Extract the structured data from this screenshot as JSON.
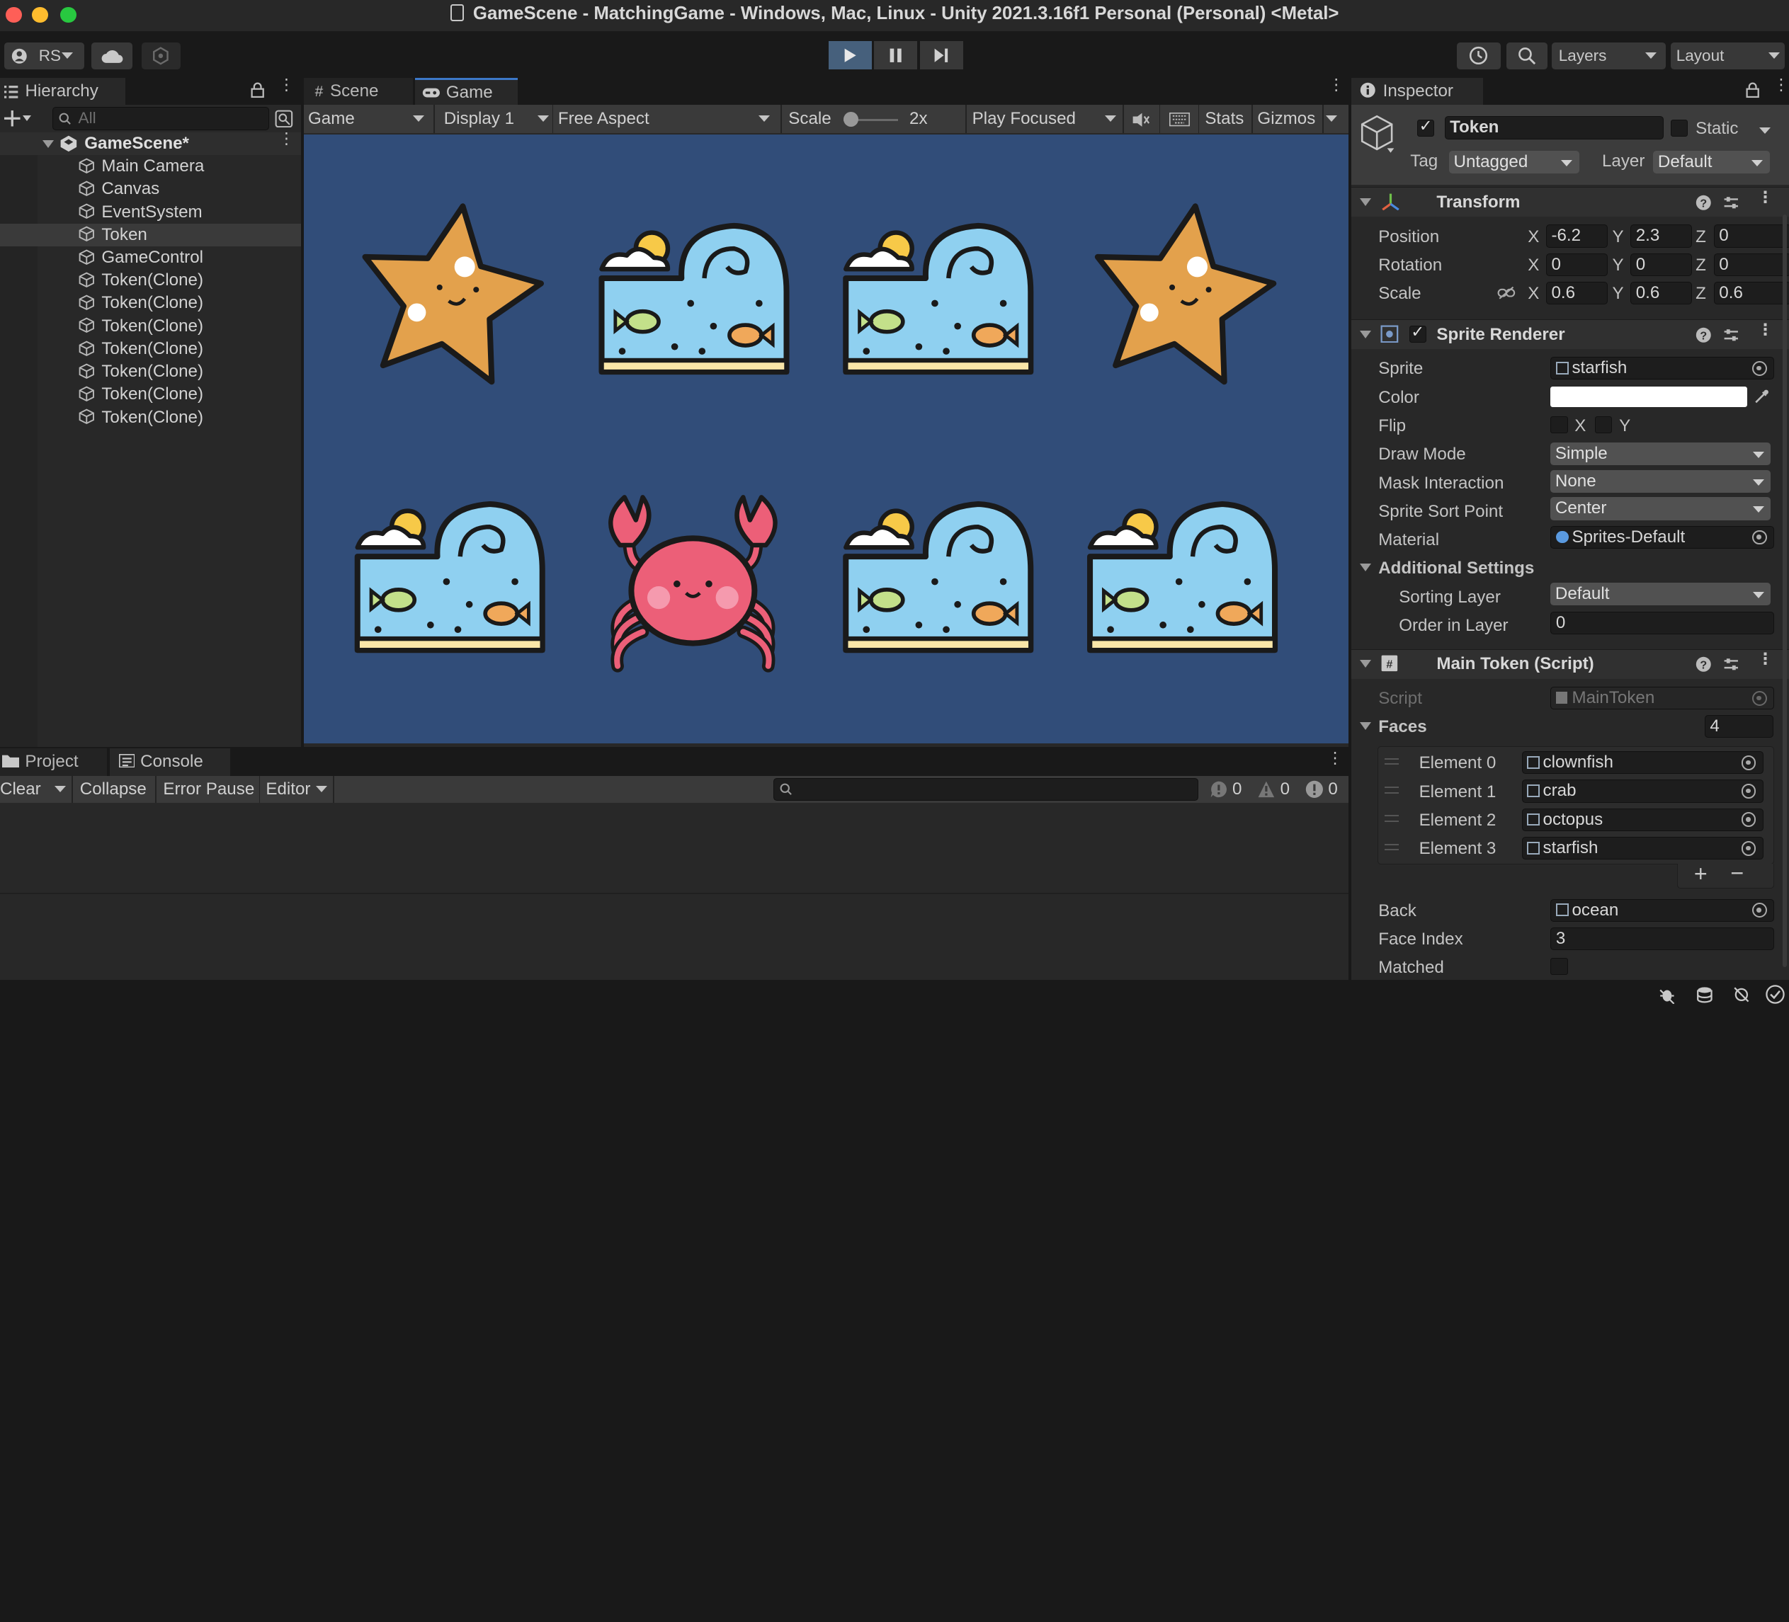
{
  "window": {
    "title": "GameScene - MatchingGame - Windows, Mac, Linux - Unity 2021.3.16f1 Personal (Personal) <Metal>"
  },
  "toolbar": {
    "account_label": "RS",
    "layers_label": "Layers",
    "layout_label": "Layout",
    "icons": [
      "account-icon",
      "cloud-icon",
      "collab-icon",
      "play-icon",
      "pause-icon",
      "step-icon",
      "history-icon",
      "search-icon"
    ]
  },
  "hierarchy": {
    "tab_label": "Hierarchy",
    "search_placeholder": "All",
    "scene_name": "GameScene*",
    "items": [
      {
        "label": "Main Camera"
      },
      {
        "label": "Canvas"
      },
      {
        "label": "EventSystem"
      },
      {
        "label": "Token"
      },
      {
        "label": "GameControl"
      },
      {
        "label": "Token(Clone)"
      },
      {
        "label": "Token(Clone)"
      },
      {
        "label": "Token(Clone)"
      },
      {
        "label": "Token(Clone)"
      },
      {
        "label": "Token(Clone)"
      },
      {
        "label": "Token(Clone)"
      },
      {
        "label": "Token(Clone)"
      }
    ],
    "selected_index": 3
  },
  "game_view": {
    "tabs": [
      {
        "label": "Scene"
      },
      {
        "label": "Game"
      }
    ],
    "active_tab": "Game",
    "toolbar": {
      "view": "Game",
      "display": "Display 1",
      "aspect": "Free Aspect",
      "scale_label": "Scale",
      "scale_value": "2x",
      "play_mode": "Play Focused",
      "stats": "Stats",
      "gizmos": "Gizmos"
    },
    "background_color": "#314d79",
    "tiles": [
      [
        "starfish",
        "ocean",
        "ocean",
        "starfish"
      ],
      [
        "ocean",
        "crab",
        "ocean",
        "ocean"
      ]
    ]
  },
  "console": {
    "tabs": [
      {
        "label": "Project"
      },
      {
        "label": "Console"
      }
    ],
    "active_tab": "Console",
    "toolbar": {
      "clear": "Clear",
      "collapse": "Collapse",
      "error_pause": "Error Pause",
      "editor": "Editor"
    },
    "counts": {
      "info": "0",
      "warn": "0",
      "error": "0"
    }
  },
  "inspector": {
    "tab_label": "Inspector",
    "object_name": "Token",
    "static_label": "Static",
    "tag_label": "Tag",
    "tag_value": "Untagged",
    "layer_label": "Layer",
    "layer_value": "Default",
    "transform": {
      "title": "Transform",
      "position_label": "Position",
      "rotation_label": "Rotation",
      "scale_label": "Scale",
      "position": {
        "x": "-6.2",
        "y": "2.3",
        "z": "0"
      },
      "rotation": {
        "x": "0",
        "y": "0",
        "z": "0"
      },
      "scale": {
        "x": "0.6",
        "y": "0.6",
        "z": "0.6"
      }
    },
    "sprite_renderer": {
      "title": "Sprite Renderer",
      "sprite_label": "Sprite",
      "sprite_value": "starfish",
      "color_label": "Color",
      "color_value": "#ffffff",
      "flip_label": "Flip",
      "flip_x": "X",
      "flip_y": "Y",
      "draw_mode_label": "Draw Mode",
      "draw_mode_value": "Simple",
      "mask_label": "Mask Interaction",
      "mask_value": "None",
      "sort_point_label": "Sprite Sort Point",
      "sort_point_value": "Center",
      "material_label": "Material",
      "material_value": "Sprites-Default",
      "additional_label": "Additional Settings",
      "sorting_layer_label": "Sorting Layer",
      "sorting_layer_value": "Default",
      "order_label": "Order in Layer",
      "order_value": "0"
    },
    "main_token": {
      "title": "Main Token (Script)",
      "script_label": "Script",
      "script_value": "MainToken",
      "faces_label": "Faces",
      "faces_count": "4",
      "elements": [
        {
          "label": "Element 0",
          "value": "clownfish"
        },
        {
          "label": "Element 1",
          "value": "crab"
        },
        {
          "label": "Element 2",
          "value": "octopus"
        },
        {
          "label": "Element 3",
          "value": "starfish"
        }
      ],
      "back_label": "Back",
      "back_value": "ocean",
      "face_index_label": "Face Index",
      "face_index_value": "3",
      "matched_label": "Matched"
    }
  }
}
